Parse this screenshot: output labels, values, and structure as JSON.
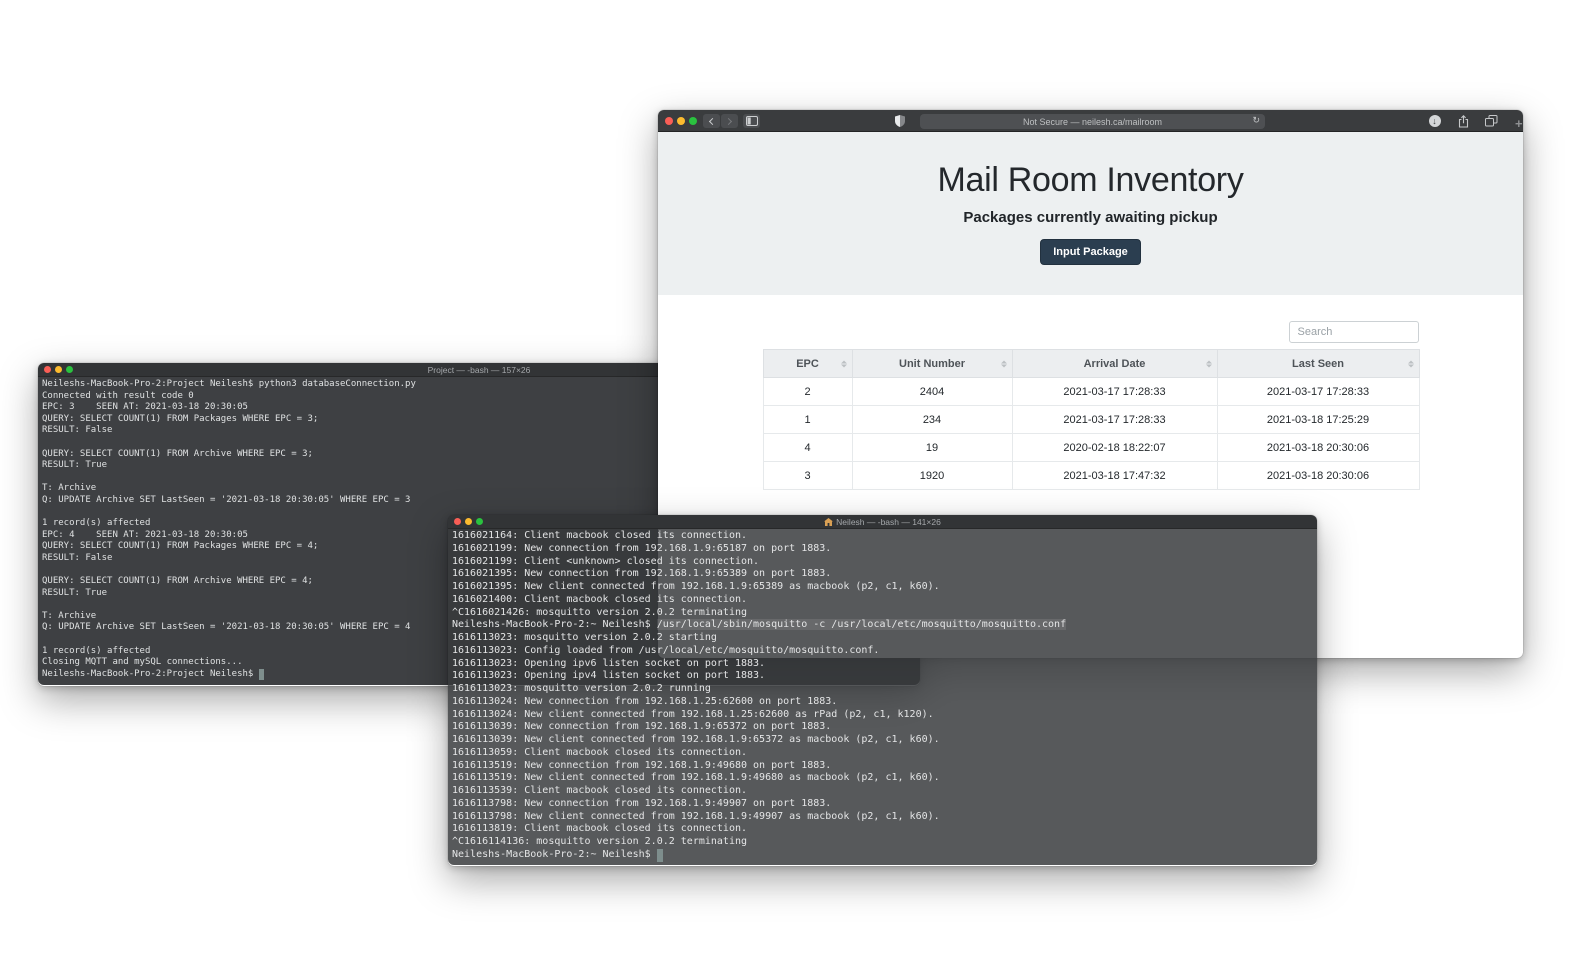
{
  "colors": {
    "accent_button": "#2b3e50",
    "jumbotron_bg": "#edf0f1",
    "terminal1_bg": "#3e4043",
    "terminal2_bg": "rgba(55,57,60,0.84)",
    "browser_chrome_bg": "#3a3c3e",
    "traffic_red": "#f95e56",
    "traffic_yellow": "#fcbb2f",
    "traffic_green": "#2ac23f",
    "terminal_cursor": "#7e8e8d"
  },
  "terminal1": {
    "title": "Project — -bash — 157×26",
    "lines": [
      "Neileshs-MacBook-Pro-2:Project Neilesh$ python3 databaseConnection.py",
      "Connected with result code 0",
      "EPC: 3    SEEN AT: 2021-03-18 20:30:05",
      "QUERY: SELECT COUNT(1) FROM Packages WHERE EPC = 3;",
      "RESULT: False",
      "",
      "QUERY: SELECT COUNT(1) FROM Archive WHERE EPC = 3;",
      "RESULT: True",
      "",
      "T: Archive",
      "Q: UPDATE Archive SET LastSeen = '2021-03-18 20:30:05' WHERE EPC = 3",
      "",
      "1 record(s) affected",
      "EPC: 4    SEEN AT: 2021-03-18 20:30:05",
      "QUERY: SELECT COUNT(1) FROM Packages WHERE EPC = 4;",
      "RESULT: False",
      "",
      "QUERY: SELECT COUNT(1) FROM Archive WHERE EPC = 4;",
      "RESULT: True",
      "",
      "T: Archive",
      "Q: UPDATE Archive SET LastSeen = '2021-03-18 20:30:05' WHERE EPC = 4",
      "",
      "1 record(s) affected",
      "Closing MQTT and mySQL connections...",
      {
        "text": "Neileshs-MacBook-Pro-2:Project Neilesh$ ",
        "cursor": true
      }
    ]
  },
  "terminal2": {
    "title": "Neilesh — -bash — 141×26",
    "title_icon": "home-icon",
    "lines": [
      "1616021164: Client macbook closed its connection.",
      "1616021199: New connection from 192.168.1.9:65187 on port 1883.",
      "1616021199: Client <unknown> closed its connection.",
      "1616021395: New connection from 192.168.1.9:65389 on port 1883.",
      "1616021395: New client connected from 192.168.1.9:65389 as macbook (p2, c1, k60).",
      "1616021400: Client macbook closed its connection.",
      "^C1616021426: mosquitto version 2.0.2 terminating",
      {
        "pre": "Neileshs-MacBook-Pro-2:~ Neilesh$ ",
        "sel": "/usr/local/sbin/mosquitto -c /usr/local/etc/mosquitto/mosquitto.conf"
      },
      "1616113023: mosquitto version 2.0.2 starting",
      "1616113023: Config loaded from /usr/local/etc/mosquitto/mosquitto.conf.",
      "1616113023: Opening ipv6 listen socket on port 1883.",
      "1616113023: Opening ipv4 listen socket on port 1883.",
      "1616113023: mosquitto version 2.0.2 running",
      "1616113024: New connection from 192.168.1.25:62600 on port 1883.",
      "1616113024: New client connected from 192.168.1.25:62600 as rPad (p2, c1, k120).",
      "1616113039: New connection from 192.168.1.9:65372 on port 1883.",
      "1616113039: New client connected from 192.168.1.9:65372 as macbook (p2, c1, k60).",
      "1616113059: Client macbook closed its connection.",
      "1616113519: New connection from 192.168.1.9:49680 on port 1883.",
      "1616113519: New client connected from 192.168.1.9:49680 as macbook (p2, c1, k60).",
      "1616113539: Client macbook closed its connection.",
      "1616113798: New connection from 192.168.1.9:49907 on port 1883.",
      "1616113798: New client connected from 192.168.1.9:49907 as macbook (p2, c1, k60).",
      "1616113819: Client macbook closed its connection.",
      "^C1616114136: mosquitto version 2.0.2 terminating",
      {
        "text": "Neileshs-MacBook-Pro-2:~ Neilesh$ ",
        "cursor": true
      }
    ]
  },
  "safari": {
    "url_text": "Not Secure — neilesh.ca/mailroom",
    "reload_glyph": "↻",
    "download_glyph": "↓",
    "new_tab_glyph": "+",
    "toolbar_icons": [
      "back-icon",
      "forward-icon",
      "sidebar-icon",
      "shield-icon",
      "reload-icon",
      "download-icon",
      "share-icon",
      "tab-overview-icon",
      "new-tab-icon"
    ],
    "page": {
      "title": "Mail Room Inventory",
      "subtitle": "Packages currently awaiting pickup",
      "button_label": "Input Package",
      "search_placeholder": "Search",
      "table": {
        "headers": [
          "EPC",
          "Unit Number",
          "Arrival Date",
          "Last Seen"
        ],
        "sort_icon": "sort-arrows-icon",
        "rows": [
          [
            "2",
            "2404",
            "2021-03-17 17:28:33",
            "2021-03-17 17:28:33"
          ],
          [
            "1",
            "234",
            "2021-03-17 17:28:33",
            "2021-03-18 17:25:29"
          ],
          [
            "4",
            "19",
            "2020-02-18 18:22:07",
            "2021-03-18 20:30:06"
          ],
          [
            "3",
            "1920",
            "2021-03-18 17:47:32",
            "2021-03-18 20:30:06"
          ]
        ]
      }
    }
  }
}
